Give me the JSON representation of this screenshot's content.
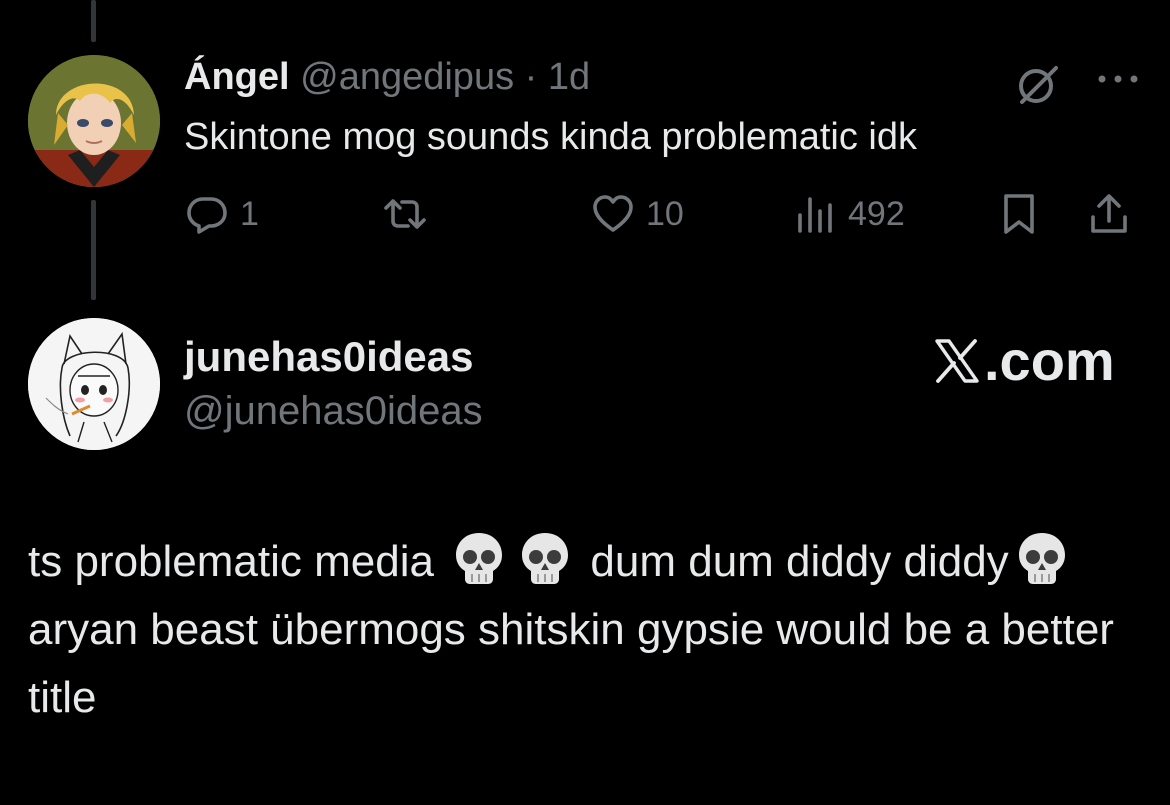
{
  "reply": {
    "name": "Ángel",
    "handle": "@angedipus",
    "separator": "·",
    "time": "1d",
    "text": "Skintone mog sounds kinda problematic idk",
    "icons": [
      "grok-icon",
      "more-icon"
    ],
    "actions": {
      "reply_count": "1",
      "retweet_count": "",
      "like_count": "10",
      "view_count": "492"
    }
  },
  "quote": {
    "name": "junehas0ideas",
    "handle": "@junehas0ideas",
    "brand": ".com",
    "body": {
      "part1": "ts problematic media",
      "part2": "dum dum diddy diddy",
      "part3": "aryan beast übermogs shitskin gypsie would be a better title",
      "emoji": "skull"
    }
  },
  "colors": {
    "background": "#000000",
    "text": "#e7e9ea",
    "secondary": "#71767b",
    "thread_line": "#333639"
  }
}
